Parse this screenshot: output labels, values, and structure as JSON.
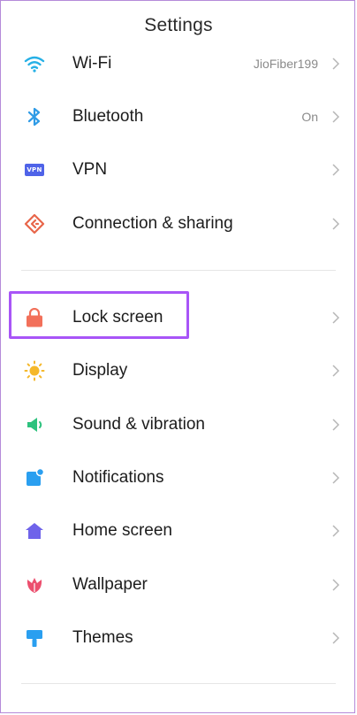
{
  "header": {
    "title": "Settings"
  },
  "settings": {
    "wifi": {
      "label": "Wi-Fi",
      "value": "JioFiber199",
      "icon": "wifi-icon",
      "color": "#26b0e6"
    },
    "bluetooth": {
      "label": "Bluetooth",
      "value": "On",
      "icon": "bluetooth-icon",
      "color": "#2f9be6"
    },
    "vpn": {
      "label": "VPN",
      "badge": "VPN",
      "icon": "vpn-icon",
      "color": "#4f63e8"
    },
    "connection": {
      "label": "Connection & sharing",
      "icon": "connection-sharing-icon",
      "color": "#e8664a"
    },
    "lock_screen": {
      "label": "Lock screen",
      "icon": "lock-icon",
      "color": "#f2705a",
      "highlighted": true,
      "highlight_color": "#a855f7"
    },
    "display": {
      "label": "Display",
      "icon": "sun-icon",
      "color": "#f5b82a"
    },
    "sound": {
      "label": "Sound & vibration",
      "icon": "speaker-icon",
      "color": "#2ec27e"
    },
    "notifications": {
      "label": "Notifications",
      "icon": "notification-icon",
      "color": "#2a9ff0"
    },
    "home_screen": {
      "label": "Home screen",
      "icon": "home-icon",
      "color": "#6f63ea"
    },
    "wallpaper": {
      "label": "Wallpaper",
      "icon": "tulip-icon",
      "color": "#ec4f6e"
    },
    "themes": {
      "label": "Themes",
      "icon": "brush-icon",
      "color": "#2a9ff0"
    }
  }
}
